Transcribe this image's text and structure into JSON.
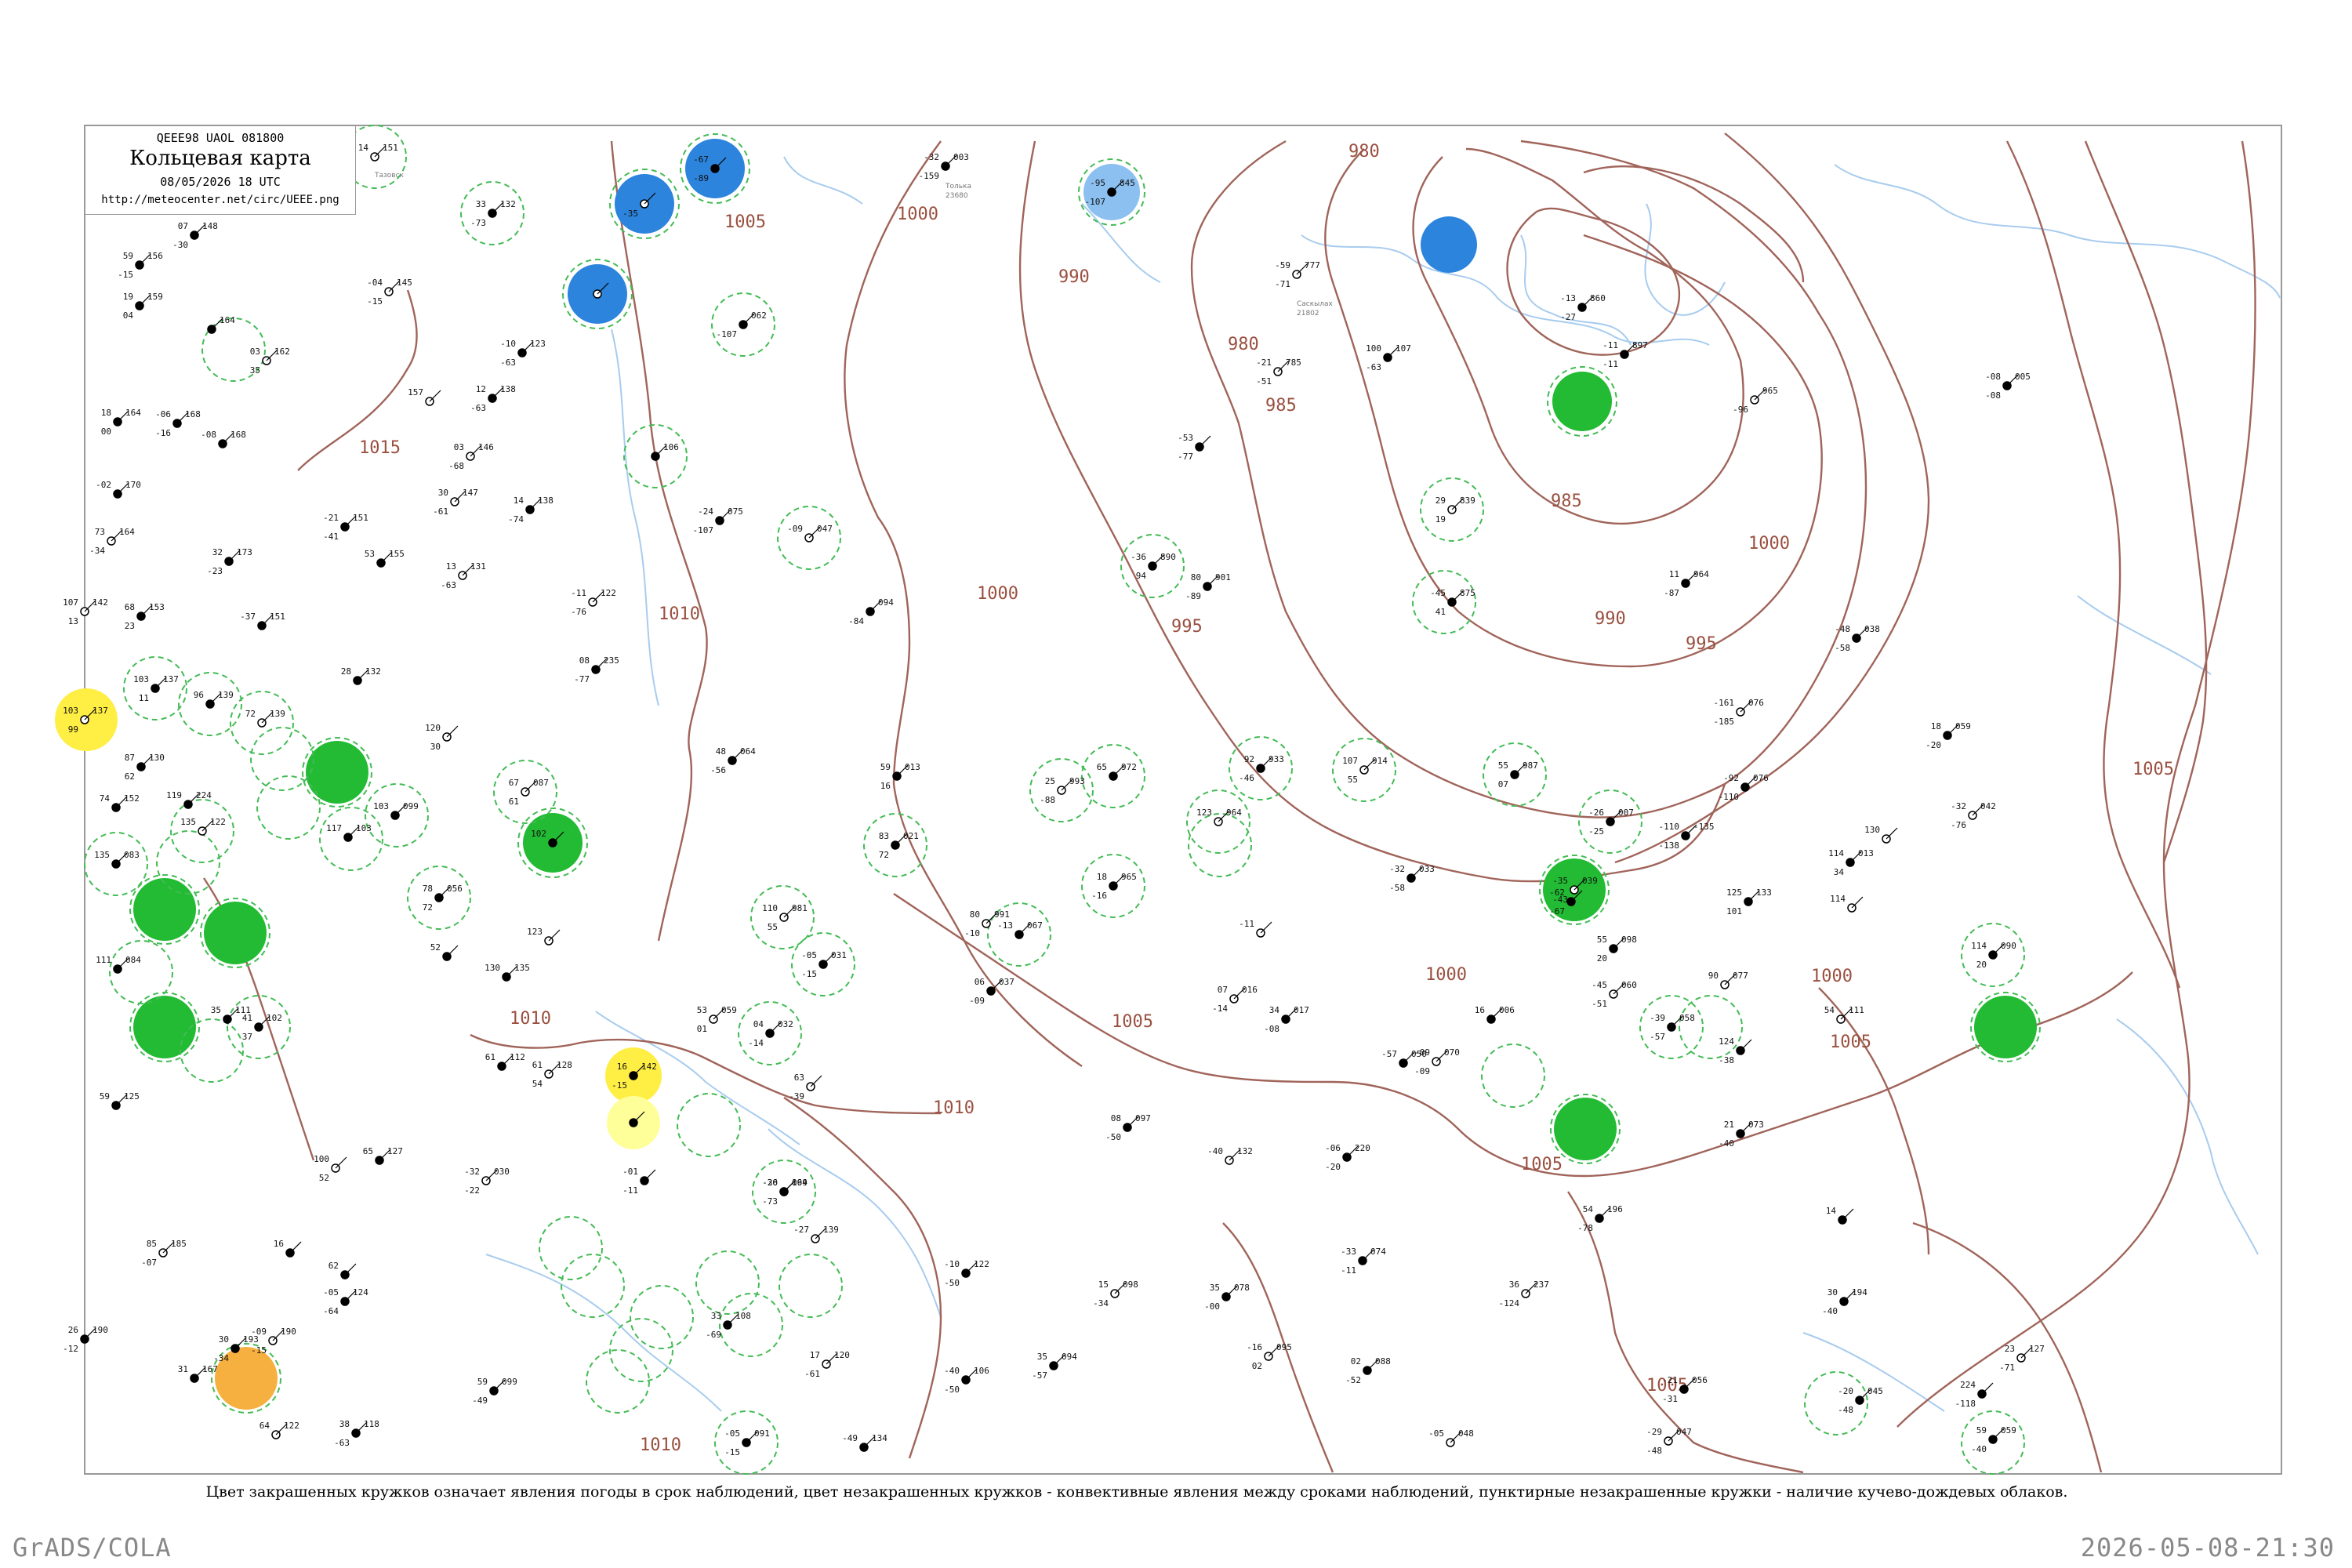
{
  "header": {
    "code": "QEEE98  UAOL  081800",
    "title": "Кольцевая карта",
    "datetime": "08/05/2026 18 UTC",
    "url": "http://meteocenter.net/circ/UEEE.png"
  },
  "caption": "Цвет закрашенных кружков означает явления погоды в срок наблюдений, цвет незакрашенных кружков - конвективные явления между сроками наблюдений, пунктирные незакрашенные кружки - наличие кучево-дождевых облаков.",
  "footer": {
    "left": "GrADS/COLA",
    "right": "2026-05-08-21:30"
  },
  "colors": {
    "isobar": "#a0645a",
    "isobar_label": "#9a5040",
    "coast": "#a8ccee",
    "rain_fill": "#22bb33",
    "snow_fill": "#2c84dd",
    "snow_fill_light": "#8cc0f0",
    "fog_fill": "#ffee44",
    "fog_fill_light": "#ffff99",
    "haze_fill": "#f5b040",
    "cb_ring": "#44bb55"
  },
  "isobar_labels": [
    "1015",
    "1005",
    "1000",
    "980",
    "990",
    "980",
    "985",
    "985",
    "1000",
    "1010",
    "1000",
    "995",
    "990",
    "995",
    "1000",
    "1005",
    "1005",
    "1010",
    "1010",
    "1000",
    "1005",
    "1005",
    "1010",
    "1005"
  ],
  "stations": [
    {
      "temp": "14",
      "press": "151",
      "dew": "",
      "id": "",
      "name": "Тазовск"
    },
    {
      "temp": "33",
      "press": "132",
      "dew": "-73",
      "id": "",
      "name": ""
    },
    {
      "temp": "-67",
      "press": "",
      "dew": "-89",
      "id": "",
      "name": ""
    },
    {
      "temp": "",
      "press": "",
      "dew": "-35",
      "id": "",
      "name": ""
    },
    {
      "temp": "-32",
      "press": "003",
      "dew": "-159",
      "id": "23680",
      "name": "Толька"
    },
    {
      "temp": "-95",
      "press": "845",
      "dew": "-107",
      "id": "",
      "name": ""
    },
    {
      "temp": "",
      "press": "",
      "dew": "",
      "id": "",
      "name": ""
    },
    {
      "temp": "07",
      "press": "148",
      "dew": "-30",
      "id": "",
      "name": ""
    },
    {
      "temp": "59",
      "press": "156",
      "dew": "-15",
      "id": "",
      "name": ""
    },
    {
      "temp": "-04",
      "press": "145",
      "dew": "-15",
      "id": "",
      "name": ""
    },
    {
      "temp": "19",
      "press": "159",
      "dew": "04",
      "id": "",
      "name": ""
    },
    {
      "temp": "",
      "press": "164",
      "dew": "",
      "id": "",
      "name": ""
    },
    {
      "temp": "03",
      "press": "162",
      "dew": "35",
      "id": "",
      "name": ""
    },
    {
      "temp": "-10",
      "press": "123",
      "dew": "-63",
      "id": "",
      "name": ""
    },
    {
      "temp": "",
      "press": "062",
      "dew": "-107",
      "id": "",
      "name": ""
    },
    {
      "temp": "-59",
      "press": "777",
      "dew": "-71",
      "id": "21802",
      "name": "Саскылах"
    },
    {
      "temp": "-13",
      "press": "860",
      "dew": "-27",
      "id": "",
      "name": ""
    },
    {
      "temp": "-11",
      "press": "897",
      "dew": "-11",
      "id": "",
      "name": ""
    },
    {
      "temp": "-21",
      "press": "785",
      "dew": "-51",
      "id": "",
      "name": ""
    },
    {
      "temp": "100",
      "press": "107",
      "dew": "-63",
      "id": "",
      "name": ""
    },
    {
      "temp": "-08",
      "press": "005",
      "dew": "-08",
      "id": "",
      "name": ""
    },
    {
      "temp": "",
      "press": "965",
      "dew": "-96",
      "id": "",
      "name": ""
    },
    {
      "temp": "18",
      "press": "164",
      "dew": "00",
      "id": "",
      "name": ""
    },
    {
      "temp": "-06",
      "press": "168",
      "dew": "-16",
      "id": "",
      "name": ""
    },
    {
      "temp": "157",
      "press": "",
      "dew": "",
      "id": "",
      "name": ""
    },
    {
      "temp": "12",
      "press": "138",
      "dew": "-63",
      "id": "",
      "name": ""
    },
    {
      "temp": "-08",
      "press": "168",
      "dew": "",
      "id": "",
      "name": ""
    },
    {
      "temp": "03",
      "press": "146",
      "dew": "-68",
      "id": "",
      "name": ""
    },
    {
      "temp": "",
      "press": "106",
      "dew": "",
      "id": "",
      "name": ""
    },
    {
      "temp": "-53",
      "press": "",
      "dew": "-77",
      "id": "",
      "name": ""
    },
    {
      "temp": "29",
      "press": "839",
      "dew": "19",
      "id": "",
      "name": ""
    },
    {
      "temp": "-02",
      "press": "170",
      "dew": "",
      "id": "",
      "name": ""
    },
    {
      "temp": "-21",
      "press": "151",
      "dew": "-41",
      "id": "",
      "name": ""
    },
    {
      "temp": "30",
      "press": "147",
      "dew": "-61",
      "id": "",
      "name": ""
    },
    {
      "temp": "14",
      "press": "138",
      "dew": "-74",
      "id": "",
      "name": ""
    },
    {
      "temp": "-24",
      "press": "075",
      "dew": "-107",
      "id": "",
      "name": ""
    },
    {
      "temp": "-09",
      "press": "047",
      "dew": "",
      "id": "",
      "name": ""
    },
    {
      "temp": "-36",
      "press": "890",
      "dew": "94",
      "id": "",
      "name": ""
    },
    {
      "temp": "80",
      "press": "901",
      "dew": "-89",
      "id": "",
      "name": ""
    },
    {
      "temp": "73",
      "press": "164",
      "dew": "-34",
      "id": "",
      "name": ""
    },
    {
      "temp": "32",
      "press": "173",
      "dew": "-23",
      "id": "",
      "name": ""
    },
    {
      "temp": "53",
      "press": "155",
      "dew": "",
      "id": "",
      "name": ""
    },
    {
      "temp": "13",
      "press": "131",
      "dew": "-63",
      "id": "",
      "name": ""
    },
    {
      "temp": "-45",
      "press": "875",
      "dew": "41",
      "id": "",
      "name": ""
    },
    {
      "temp": "11",
      "press": "964",
      "dew": "-87",
      "id": "",
      "name": ""
    },
    {
      "temp": "107",
      "press": "142",
      "dew": "13",
      "id": "",
      "name": ""
    },
    {
      "temp": "68",
      "press": "153",
      "dew": "23",
      "id": "",
      "name": ""
    },
    {
      "temp": "-37",
      "press": "151",
      "dew": "",
      "id": "",
      "name": ""
    },
    {
      "temp": "-11",
      "press": "122",
      "dew": "-76",
      "id": "",
      "name": ""
    },
    {
      "temp": "",
      "press": "094",
      "dew": "-84",
      "id": "",
      "name": ""
    },
    {
      "temp": "-48",
      "press": "038",
      "dew": "-58",
      "id": "",
      "name": ""
    },
    {
      "temp": "103",
      "press": "137",
      "dew": "99",
      "id": "",
      "name": ""
    },
    {
      "temp": "103",
      "press": "137",
      "dew": "11",
      "id": "",
      "name": ""
    },
    {
      "temp": "96",
      "press": "139",
      "dew": "",
      "id": "",
      "name": ""
    },
    {
      "temp": "72",
      "press": "139",
      "dew": "",
      "id": "",
      "name": ""
    },
    {
      "temp": "28",
      "press": "132",
      "dew": "",
      "id": "",
      "name": ""
    },
    {
      "temp": "08",
      "press": "235",
      "dew": "-77",
      "id": "",
      "name": ""
    },
    {
      "temp": "-161",
      "press": "076",
      "dew": "-185",
      "id": "",
      "name": ""
    },
    {
      "temp": "18",
      "press": "059",
      "dew": "-20",
      "id": "",
      "name": ""
    },
    {
      "temp": "87",
      "press": "130",
      "dew": "62",
      "id": "",
      "name": ""
    },
    {
      "temp": "120",
      "press": "",
      "dew": "30",
      "id": "",
      "name": ""
    },
    {
      "temp": "48",
      "press": "064",
      "dew": "-56",
      "id": "",
      "name": ""
    },
    {
      "temp": "59",
      "press": "013",
      "dew": "16",
      "id": "",
      "name": ""
    },
    {
      "temp": "25",
      "press": "993",
      "dew": "-88",
      "id": "",
      "name": ""
    },
    {
      "temp": "65",
      "press": "972",
      "dew": "",
      "id": "",
      "name": ""
    },
    {
      "temp": "92",
      "press": "933",
      "dew": "-46",
      "id": "",
      "name": ""
    },
    {
      "temp": "107",
      "press": "914",
      "dew": "55",
      "id": "",
      "name": ""
    },
    {
      "temp": "55",
      "press": "987",
      "dew": "07",
      "id": "",
      "name": ""
    },
    {
      "temp": "-92",
      "press": "076",
      "dew": "-110",
      "id": "",
      "name": ""
    },
    {
      "temp": "-32",
      "press": "042",
      "dew": "-76",
      "id": "",
      "name": ""
    },
    {
      "temp": "74",
      "press": "152",
      "dew": "",
      "id": "",
      "name": ""
    },
    {
      "temp": "119",
      "press": "224",
      "dew": "",
      "id": "",
      "name": ""
    },
    {
      "temp": "135",
      "press": "122",
      "dew": "",
      "id": "",
      "name": ""
    },
    {
      "temp": "117",
      "press": "103",
      "dew": "",
      "id": "",
      "name": ""
    },
    {
      "temp": "103",
      "press": "099",
      "dew": "",
      "id": "",
      "name": ""
    },
    {
      "temp": "67",
      "press": "087",
      "dew": "61",
      "id": "",
      "name": ""
    },
    {
      "temp": "102",
      "press": "",
      "dew": "",
      "id": "",
      "name": ""
    },
    {
      "temp": "83",
      "press": "021",
      "dew": "72",
      "id": "",
      "name": ""
    },
    {
      "temp": "123",
      "press": "964",
      "dew": "",
      "id": "",
      "name": ""
    },
    {
      "temp": "-26",
      "press": "007",
      "dew": "-25",
      "id": "",
      "name": ""
    },
    {
      "temp": "-110",
      "press": "-135",
      "dew": "-138",
      "id": "",
      "name": ""
    },
    {
      "temp": "130",
      "press": "",
      "dew": "",
      "id": "",
      "name": ""
    },
    {
      "temp": "135",
      "press": "083",
      "dew": "",
      "id": "",
      "name": ""
    },
    {
      "temp": "78",
      "press": "056",
      "dew": "72",
      "id": "",
      "name": ""
    },
    {
      "temp": "110",
      "press": "981",
      "dew": "55",
      "id": "",
      "name": ""
    },
    {
      "temp": "18",
      "press": "965",
      "dew": "-16",
      "id": "",
      "name": ""
    },
    {
      "temp": "-32",
      "press": "033",
      "dew": "-58",
      "id": "",
      "name": ""
    },
    {
      "temp": "-35",
      "press": "039",
      "dew": "-43",
      "id": "",
      "name": ""
    },
    {
      "temp": "-62",
      "press": "",
      "dew": "-67",
      "id": "",
      "name": ""
    },
    {
      "temp": "125",
      "press": "133",
      "dew": "101",
      "id": "",
      "name": ""
    },
    {
      "temp": "114",
      "press": "",
      "dew": "",
      "id": "",
      "name": ""
    },
    {
      "temp": "114",
      "press": "013",
      "dew": "34",
      "id": "",
      "name": ""
    },
    {
      "temp": "111",
      "press": "084",
      "dew": "",
      "id": "",
      "name": ""
    },
    {
      "temp": "80",
      "press": "991",
      "dew": "-10",
      "id": "",
      "name": ""
    },
    {
      "temp": "-13",
      "press": "067",
      "dew": "",
      "id": "",
      "name": ""
    },
    {
      "temp": "-05",
      "press": "031",
      "dew": "-15",
      "id": "",
      "name": ""
    },
    {
      "temp": "-11",
      "press": "",
      "dew": "",
      "id": "",
      "name": ""
    },
    {
      "temp": "114",
      "press": "090",
      "dew": "20",
      "id": "",
      "name": ""
    },
    {
      "temp": "55",
      "press": "098",
      "dew": "20",
      "id": "",
      "name": ""
    },
    {
      "temp": "90",
      "press": "077",
      "dew": "",
      "id": "",
      "name": ""
    },
    {
      "temp": "52",
      "press": "",
      "dew": "",
      "id": "",
      "name": ""
    },
    {
      "temp": "130",
      "press": "135",
      "dew": "",
      "id": "",
      "name": ""
    },
    {
      "temp": "123",
      "press": "",
      "dew": "",
      "id": "",
      "name": ""
    },
    {
      "temp": "35",
      "press": "111",
      "dew": "",
      "id": "",
      "name": ""
    },
    {
      "temp": "41",
      "press": "102",
      "dew": "37",
      "id": "",
      "name": ""
    },
    {
      "temp": "53",
      "press": "059",
      "dew": "01",
      "id": "",
      "name": ""
    },
    {
      "temp": "04",
      "press": "032",
      "dew": "-14",
      "id": "",
      "name": ""
    },
    {
      "temp": "06",
      "press": "037",
      "dew": "-09",
      "id": "",
      "name": ""
    },
    {
      "temp": "07",
      "press": "016",
      "dew": "-14",
      "id": "",
      "name": ""
    },
    {
      "temp": "34",
      "press": "017",
      "dew": "-08",
      "id": "",
      "name": ""
    },
    {
      "temp": "16",
      "press": "006",
      "dew": "",
      "id": "",
      "name": ""
    },
    {
      "temp": "-45",
      "press": "060",
      "dew": "-51",
      "id": "",
      "name": ""
    },
    {
      "temp": "-39",
      "press": "058",
      "dew": "-57",
      "id": "",
      "name": ""
    },
    {
      "temp": "124",
      "press": "",
      "dew": "-38",
      "id": "",
      "name": ""
    },
    {
      "temp": "54",
      "press": "111",
      "dew": "",
      "id": "",
      "name": ""
    },
    {
      "temp": "59",
      "press": "125",
      "dew": "",
      "id": "",
      "name": ""
    },
    {
      "temp": "61",
      "press": "112",
      "dew": "",
      "id": "",
      "name": ""
    },
    {
      "temp": "61",
      "press": "128",
      "dew": "54",
      "id": "",
      "name": ""
    },
    {
      "temp": "16",
      "press": "142",
      "dew": "-15",
      "id": "",
      "name": ""
    },
    {
      "temp": "",
      "press": "",
      "dew": "",
      "id": "",
      "name": ""
    },
    {
      "temp": "63",
      "press": "",
      "dew": "-39",
      "id": "",
      "name": ""
    },
    {
      "temp": "-26",
      "press": "094",
      "dew": "",
      "id": "",
      "name": ""
    },
    {
      "temp": "-57",
      "press": "050",
      "dew": "",
      "id": "",
      "name": ""
    },
    {
      "temp": "-09",
      "press": "070",
      "dew": "-09",
      "id": "",
      "name": ""
    },
    {
      "temp": "08",
      "press": "097",
      "dew": "-50",
      "id": "",
      "name": ""
    },
    {
      "temp": "21",
      "press": "073",
      "dew": "-40",
      "id": "",
      "name": ""
    },
    {
      "temp": "-40",
      "press": "132",
      "dew": "",
      "id": "",
      "name": ""
    },
    {
      "temp": "-06",
      "press": "220",
      "dew": "-20",
      "id": "",
      "name": ""
    },
    {
      "temp": "-01",
      "press": "",
      "dew": "-11",
      "id": "",
      "name": ""
    },
    {
      "temp": "100",
      "press": "",
      "dew": "52",
      "id": "",
      "name": ""
    },
    {
      "temp": "65",
      "press": "127",
      "dew": "",
      "id": "",
      "name": ""
    },
    {
      "temp": "-30",
      "press": "169",
      "dew": "-73",
      "id": "",
      "name": ""
    },
    {
      "temp": "-32",
      "press": "030",
      "dew": "-22",
      "id": "",
      "name": ""
    },
    {
      "temp": "54",
      "press": "196",
      "dew": "-78",
      "id": "",
      "name": ""
    },
    {
      "temp": "14",
      "press": "",
      "dew": "",
      "id": "",
      "name": ""
    },
    {
      "temp": "85",
      "press": "185",
      "dew": "-07",
      "id": "",
      "name": ""
    },
    {
      "temp": "16",
      "press": "",
      "dew": "",
      "id": "",
      "name": ""
    },
    {
      "temp": "62",
      "press": "",
      "dew": "",
      "id": "",
      "name": ""
    },
    {
      "temp": "-27",
      "press": "139",
      "dew": "",
      "id": "",
      "name": ""
    },
    {
      "temp": "-05",
      "press": "124",
      "dew": "-64",
      "id": "",
      "name": ""
    },
    {
      "temp": "-10",
      "press": "122",
      "dew": "-50",
      "id": "",
      "name": ""
    },
    {
      "temp": "15",
      "press": "098",
      "dew": "-34",
      "id": "",
      "name": ""
    },
    {
      "temp": "35",
      "press": "078",
      "dew": "-00",
      "id": "",
      "name": ""
    },
    {
      "temp": "-33",
      "press": "074",
      "dew": "-11",
      "id": "",
      "name": ""
    },
    {
      "temp": "36",
      "press": "237",
      "dew": "-124",
      "id": "",
      "name": ""
    },
    {
      "temp": "30",
      "press": "194",
      "dew": "-40",
      "id": "",
      "name": ""
    },
    {
      "temp": "26",
      "press": "190",
      "dew": "-12",
      "id": "",
      "name": ""
    },
    {
      "temp": "-09",
      "press": "190",
      "dew": "-15",
      "id": "",
      "name": ""
    },
    {
      "temp": "30",
      "press": "193",
      "dew": "-34",
      "id": "",
      "name": ""
    },
    {
      "temp": "31",
      "press": "167",
      "dew": "",
      "id": "",
      "name": ""
    },
    {
      "temp": "64",
      "press": "122",
      "dew": "",
      "id": "",
      "name": ""
    },
    {
      "temp": "59",
      "press": "099",
      "dew": "-49",
      "id": "",
      "name": ""
    },
    {
      "temp": "33",
      "press": "108",
      "dew": "-69",
      "id": "",
      "name": ""
    },
    {
      "temp": "17",
      "press": "120",
      "dew": "-61",
      "id": "",
      "name": ""
    },
    {
      "temp": "-40",
      "press": "106",
      "dew": "-50",
      "id": "",
      "name": ""
    },
    {
      "temp": "35",
      "press": "094",
      "dew": "-57",
      "id": "",
      "name": ""
    },
    {
      "temp": "-16",
      "press": "095",
      "dew": "02",
      "id": "",
      "name": ""
    },
    {
      "temp": "02",
      "press": "088",
      "dew": "-52",
      "id": "",
      "name": ""
    },
    {
      "temp": "-21",
      "press": "056",
      "dew": "-31",
      "id": "",
      "name": ""
    },
    {
      "temp": "-29",
      "press": "047",
      "dew": "-48",
      "id": "",
      "name": ""
    },
    {
      "temp": "-20",
      "press": "045",
      "dew": "-48",
      "id": "",
      "name": ""
    },
    {
      "temp": "59",
      "press": "059",
      "dew": "-40",
      "id": "",
      "name": ""
    },
    {
      "temp": "23",
      "press": "127",
      "dew": "-71",
      "id": "",
      "name": ""
    },
    {
      "temp": "-05",
      "press": "091",
      "dew": "-15",
      "id": "",
      "name": ""
    },
    {
      "temp": "38",
      "press": "118",
      "dew": "-63",
      "id": "",
      "name": ""
    },
    {
      "temp": "-05",
      "press": "048",
      "dew": "",
      "id": "",
      "name": ""
    },
    {
      "temp": "-49",
      "press": "134",
      "dew": "",
      "id": "",
      "name": ""
    },
    {
      "temp": "224",
      "press": "",
      "dew": "-118",
      "id": "",
      "name": ""
    }
  ]
}
